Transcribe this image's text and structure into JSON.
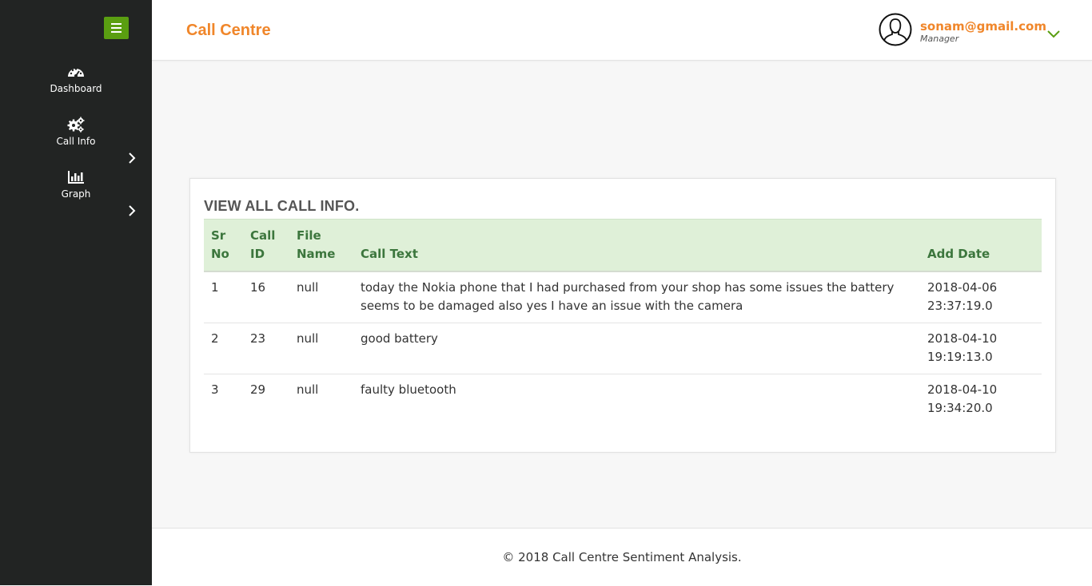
{
  "sidebar": {
    "items": [
      {
        "label": "Dashboard",
        "icon": "dashboard-icon"
      },
      {
        "label": "Call Info",
        "icon": "cogs-icon"
      },
      {
        "label": "Graph",
        "icon": "bar-chart-icon"
      }
    ]
  },
  "header": {
    "title": "Call Centre",
    "user_email": "sonam@gmail.com",
    "user_role": "Manager"
  },
  "main": {
    "card_title": "VIEW ALL CALL INFO.",
    "columns": [
      "Sr No",
      "Call ID",
      "File Name",
      "Call Text",
      "Add Date"
    ],
    "rows": [
      {
        "sr_no": "1",
        "call_id": "16",
        "file_name": "null",
        "call_text": "today the Nokia phone that I had purchased from your shop has some issues the battery seems to be damaged also yes I have an issue with the camera",
        "add_date": "2018-04-06 23:37:19.0"
      },
      {
        "sr_no": "2",
        "call_id": "23",
        "file_name": "null",
        "call_text": "good battery",
        "add_date": "2018-04-10 19:19:13.0"
      },
      {
        "sr_no": "3",
        "call_id": "29",
        "file_name": "null",
        "call_text": "faulty bluetooth",
        "add_date": "2018-04-10 19:34:20.0"
      }
    ]
  },
  "footer": {
    "text": "© 2018 Call Centre Sentiment Analysis."
  },
  "colors": {
    "accent": "#f0862a",
    "menu_green": "#5a9e11",
    "sidebar_bg": "#222423",
    "table_header_bg": "#dff0d8",
    "table_header_text": "#3c763d"
  }
}
